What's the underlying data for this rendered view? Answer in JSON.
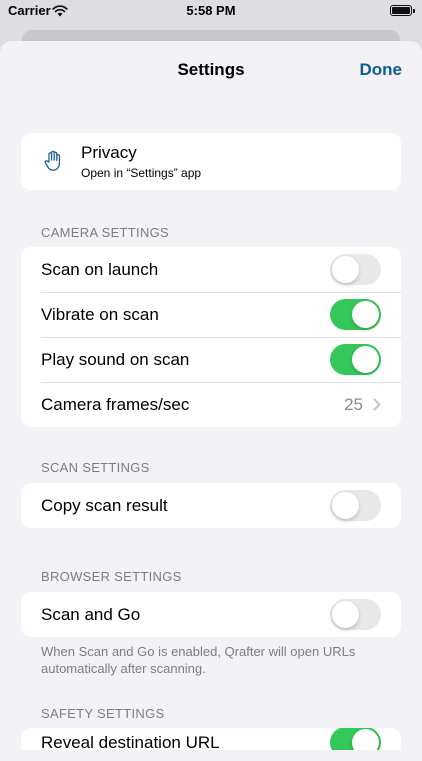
{
  "status_bar": {
    "carrier": "Carrier",
    "time": "5:58 PM"
  },
  "nav": {
    "title": "Settings",
    "done_label": "Done"
  },
  "privacy": {
    "title": "Privacy",
    "subtitle": "Open in “Settings” app"
  },
  "camera_settings": {
    "header": "CAMERA SETTINGS",
    "scan_on_launch": {
      "label": "Scan on launch",
      "enabled": false
    },
    "vibrate_on_scan": {
      "label": "Vibrate on scan",
      "enabled": true
    },
    "play_sound_on_scan": {
      "label": "Play sound on scan",
      "enabled": true
    },
    "camera_fps": {
      "label": "Camera frames/sec",
      "value": "25"
    }
  },
  "scan_settings": {
    "header": "SCAN SETTINGS",
    "copy_scan_result": {
      "label": "Copy scan result",
      "enabled": false
    }
  },
  "browser_settings": {
    "header": "BROWSER SETTINGS",
    "scan_and_go": {
      "label": "Scan and Go",
      "enabled": false
    },
    "footer": "When Scan and Go is enabled, Qrafter will open URLs automatically after scanning."
  },
  "safety_settings": {
    "header": "SAFETY SETTINGS",
    "reveal_destination_url": {
      "label": "Reveal destination URL",
      "enabled": true
    }
  },
  "colors": {
    "accent": "#0e5e93",
    "toggle_on": "#34c759",
    "toggle_off": "#e8e8ea"
  }
}
